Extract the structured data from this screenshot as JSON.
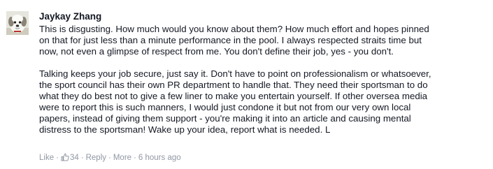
{
  "comment": {
    "author": "Jaykay Zhang",
    "paragraphs": [
      "This is disgusting. How much would you know about them? How much effort and hopes pinned\non that for just less than a minute performance in the pool. I always respected straits time but\nnow, not even a glimpse of respect from me. You don't define their job, yes - you don't.",
      "Talking keeps your job secure, just say it. Don't have to point on professionalism or whatsoever,\nthe sport council has their own PR department to handle that. They need their sportsman to do\nwhat they do best not to give a few liner to make you entertain yourself. If other oversea media\nwere to report this is such manners, I would just condone it but not from our very own local\npapers, instead of giving them support - you're making it into an article and causing mental\ndistress to the sportsman! Wake up your idea, report what is needed. L"
    ],
    "actions": {
      "like_label": "Like",
      "like_count": "34",
      "reply_label": "Reply",
      "more_label": "More",
      "timestamp": "6 hours ago",
      "separator": "·"
    },
    "icons": {
      "avatar": "dog-avatar-icon",
      "like": "thumbs-up-icon"
    },
    "colors": {
      "author": "#141823",
      "text": "#141823",
      "meta": "#9197a3"
    }
  }
}
